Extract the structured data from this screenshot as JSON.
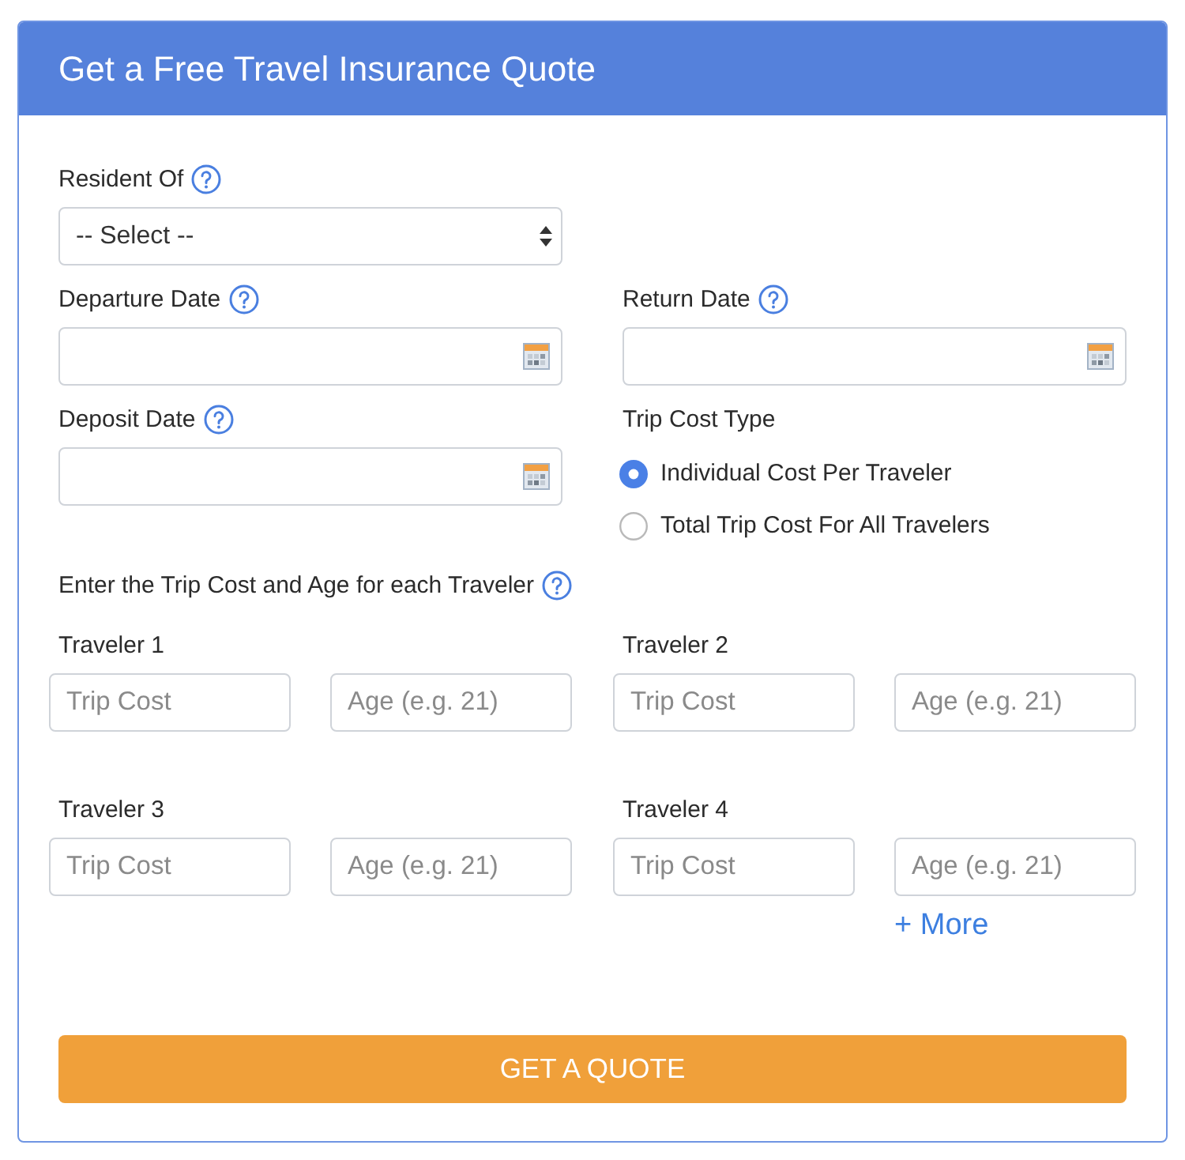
{
  "header": {
    "title": "Get a Free Travel Insurance Quote"
  },
  "form_rows": [
    [
      {
        "kind": "select",
        "label": "Resident Of",
        "help": true,
        "value": "-- Select --"
      }
    ],
    [
      {
        "kind": "date",
        "label": "Departure Date",
        "help": true
      },
      {
        "kind": "date",
        "label": "Return Date",
        "help": true
      }
    ],
    [
      {
        "kind": "date",
        "label": "Deposit Date",
        "help": true
      },
      {
        "kind": "radio_group",
        "label": "Trip Cost Type",
        "options": [
          {
            "label": "Individual Cost Per Traveler",
            "selected": true
          },
          {
            "label": "Total Trip Cost For All Travelers",
            "selected": false
          }
        ]
      }
    ]
  ],
  "travelers_section": {
    "label": "Enter the Trip Cost and Age for each Traveler",
    "help": true
  },
  "travelers": [
    {
      "label": "Traveler 1",
      "trip_cost": {
        "placeholder": "Trip Cost"
      },
      "age": {
        "placeholder": "Age (e.g. 21)"
      }
    },
    {
      "label": "Traveler 2",
      "trip_cost": {
        "placeholder": "Trip Cost"
      },
      "age": {
        "placeholder": "Age (e.g. 21)"
      }
    },
    {
      "label": "Traveler 3",
      "trip_cost": {
        "placeholder": "Trip Cost"
      },
      "age": {
        "placeholder": "Age (e.g. 21)"
      }
    },
    {
      "label": "Traveler 4",
      "trip_cost": {
        "placeholder": "Trip Cost"
      },
      "age": {
        "placeholder": "Age (e.g. 21)"
      }
    }
  ],
  "more_link": {
    "label": "+ More"
  },
  "submit_button": {
    "label": "GET A QUOTE"
  }
}
